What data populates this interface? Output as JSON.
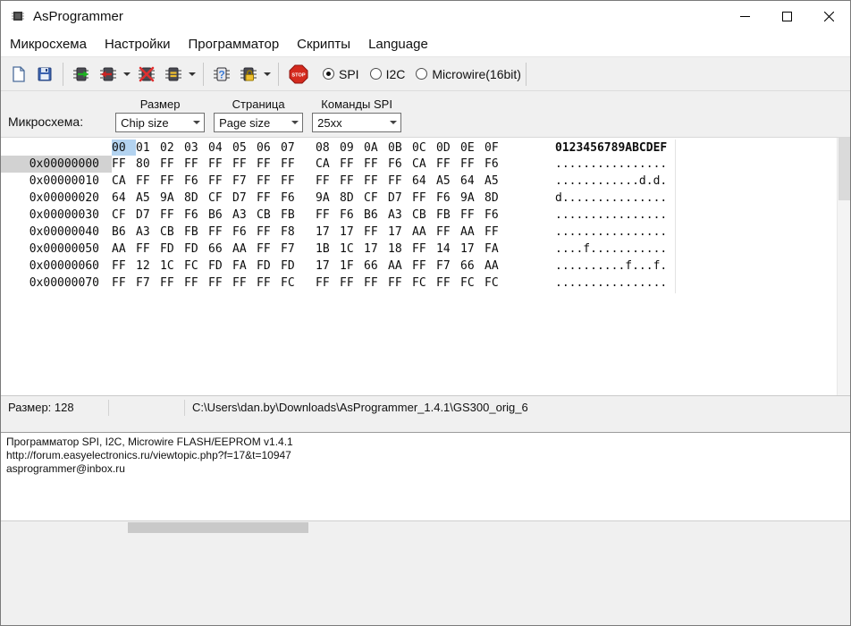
{
  "window": {
    "title": "AsProgrammer"
  },
  "menu": {
    "items": [
      "Микросхема",
      "Настройки",
      "Программатор",
      "Скрипты",
      "Language"
    ]
  },
  "toolbar": {
    "buttons": [
      "open-file",
      "save-file",
      "read-chip",
      "write-chip",
      "erase-chip",
      "verify-chip",
      "detect-chip",
      "protection",
      "stop"
    ],
    "stop_label": "STOP",
    "radios": [
      {
        "label": "SPI",
        "selected": true
      },
      {
        "label": "I2C",
        "selected": false
      },
      {
        "label": "Microwire(16bit)",
        "selected": false
      }
    ]
  },
  "chip_panel": {
    "label": "Микросхема:",
    "groups": [
      {
        "label": "Размер",
        "value": "Chip size"
      },
      {
        "label": "Страница",
        "value": "Page size"
      },
      {
        "label": "Команды SPI",
        "value": "25xx"
      }
    ]
  },
  "hex_editor": {
    "col_headers": [
      "00",
      "01",
      "02",
      "03",
      "04",
      "05",
      "06",
      "07",
      "08",
      "09",
      "0A",
      "0B",
      "0C",
      "0D",
      "0E",
      "0F"
    ],
    "ascii_header": "0123456789ABCDEF",
    "rows": [
      {
        "addr": "0x00000000",
        "bytes": [
          "FF",
          "80",
          "FF",
          "FF",
          "FF",
          "FF",
          "FF",
          "FF",
          "CA",
          "FF",
          "FF",
          "F6",
          "CA",
          "FF",
          "FF",
          "F6"
        ],
        "ascii": "................"
      },
      {
        "addr": "0x00000010",
        "bytes": [
          "CA",
          "FF",
          "FF",
          "F6",
          "FF",
          "F7",
          "FF",
          "FF",
          "FF",
          "FF",
          "FF",
          "FF",
          "64",
          "A5",
          "64",
          "A5"
        ],
        "ascii": "............d.d."
      },
      {
        "addr": "0x00000020",
        "bytes": [
          "64",
          "A5",
          "9A",
          "8D",
          "CF",
          "D7",
          "FF",
          "F6",
          "9A",
          "8D",
          "CF",
          "D7",
          "FF",
          "F6",
          "9A",
          "8D"
        ],
        "ascii": "d..............."
      },
      {
        "addr": "0x00000030",
        "bytes": [
          "CF",
          "D7",
          "FF",
          "F6",
          "B6",
          "A3",
          "CB",
          "FB",
          "FF",
          "F6",
          "B6",
          "A3",
          "CB",
          "FB",
          "FF",
          "F6"
        ],
        "ascii": "................"
      },
      {
        "addr": "0x00000040",
        "bytes": [
          "B6",
          "A3",
          "CB",
          "FB",
          "FF",
          "F6",
          "FF",
          "F8",
          "17",
          "17",
          "FF",
          "17",
          "AA",
          "FF",
          "AA",
          "FF"
        ],
        "ascii": "................"
      },
      {
        "addr": "0x00000050",
        "bytes": [
          "AA",
          "FF",
          "FD",
          "FD",
          "66",
          "AA",
          "FF",
          "F7",
          "1B",
          "1C",
          "17",
          "18",
          "FF",
          "14",
          "17",
          "FA"
        ],
        "ascii": "....f..........."
      },
      {
        "addr": "0x00000060",
        "bytes": [
          "FF",
          "12",
          "1C",
          "FC",
          "FD",
          "FA",
          "FD",
          "FD",
          "17",
          "1F",
          "66",
          "AA",
          "FF",
          "F7",
          "66",
          "AA"
        ],
        "ascii": "..........f...f."
      },
      {
        "addr": "0x00000070",
        "bytes": [
          "FF",
          "F7",
          "FF",
          "FF",
          "FF",
          "FF",
          "FF",
          "FC",
          "FF",
          "FF",
          "FF",
          "FF",
          "FC",
          "FF",
          "FC",
          "FC"
        ],
        "ascii": "................"
      }
    ]
  },
  "statusbar": {
    "size": "Размер: 128",
    "path": "C:\\Users\\dan.by\\Downloads\\AsProgrammer_1.4.1\\GS300_orig_6"
  },
  "log": {
    "lines": [
      "Программатор SPI, I2C, Microwire FLASH/EEPROM v1.4.1",
      "http://forum.easyelectronics.ru/viewtopic.php?f=17&t=10947",
      "asprogrammer@inbox.ru"
    ]
  },
  "colors": {
    "header_selection_blue": "#b3d3f0",
    "address_selection_gray": "#d2d2d2",
    "stop_red": "#d42a1e"
  }
}
